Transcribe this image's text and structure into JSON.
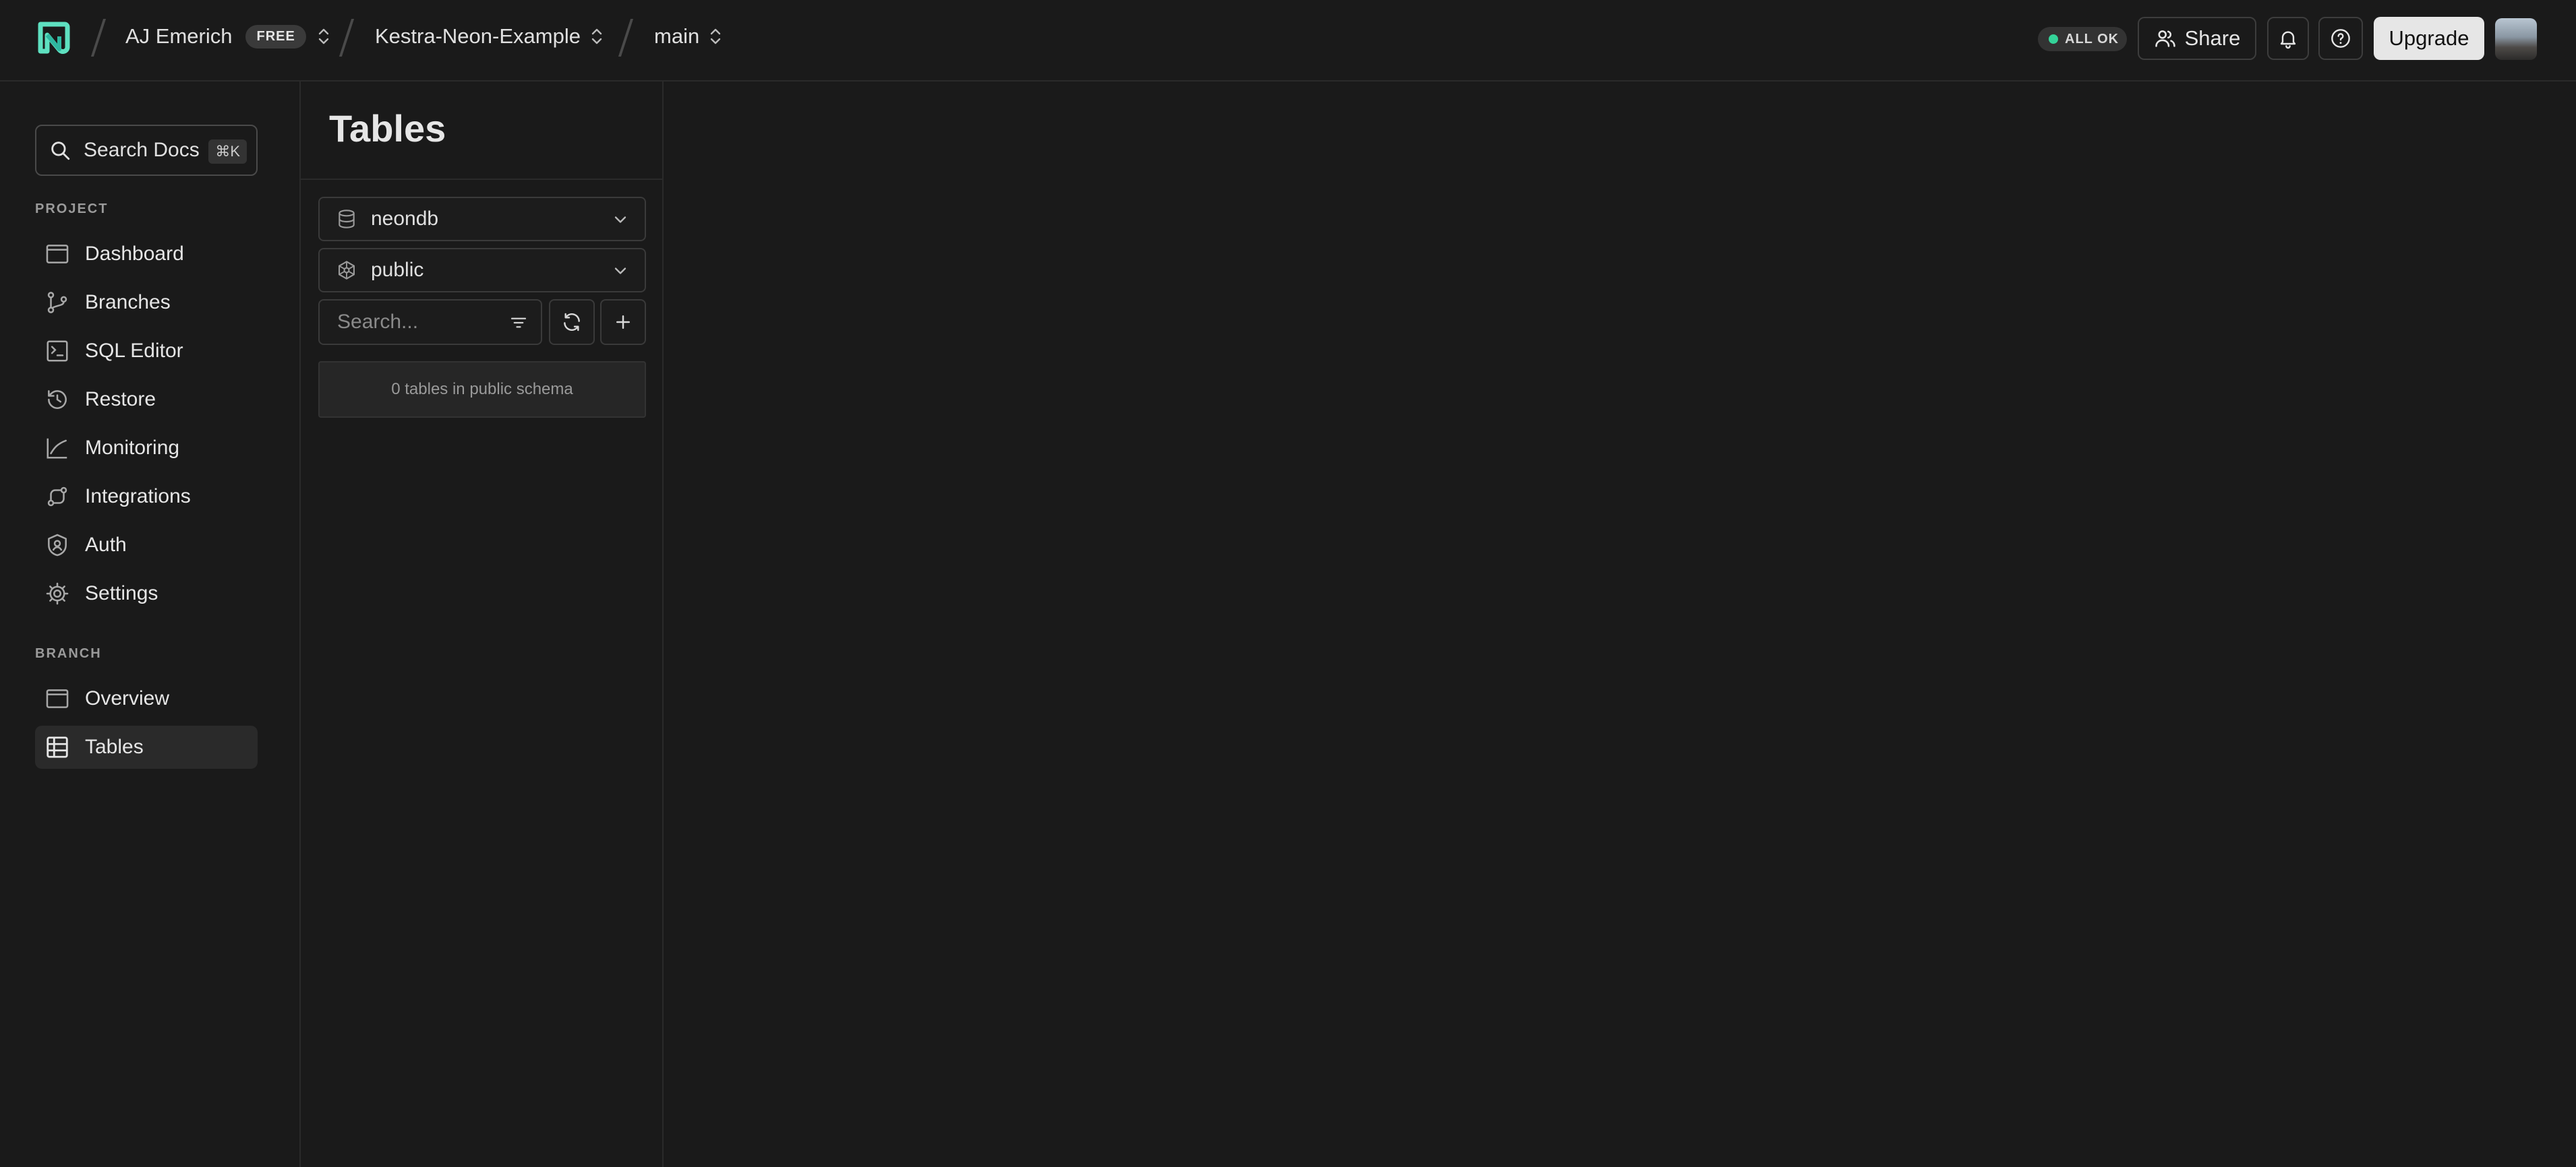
{
  "topbar": {
    "org_name": "AJ Emerich",
    "org_plan_badge": "FREE",
    "project_name": "Kestra-Neon-Example",
    "branch_name": "main",
    "status_text": "ALL OK",
    "status_color": "#34d399",
    "share_label": "Share",
    "upgrade_label": "Upgrade",
    "icons": [
      "neon-logo-icon",
      "chevron-up-down-icon",
      "users-icon",
      "bell-icon",
      "help-circle-icon"
    ]
  },
  "sidebar": {
    "search": {
      "label": "Search Docs",
      "shortcut": "⌘K"
    },
    "project_section": "PROJECT",
    "project_items": [
      {
        "label": "Dashboard",
        "icon": "dashboard-icon"
      },
      {
        "label": "Branches",
        "icon": "branches-icon"
      },
      {
        "label": "SQL Editor",
        "icon": "sql-editor-icon"
      },
      {
        "label": "Restore",
        "icon": "restore-icon"
      },
      {
        "label": "Monitoring",
        "icon": "monitoring-icon"
      },
      {
        "label": "Integrations",
        "icon": "integrations-icon"
      },
      {
        "label": "Auth",
        "icon": "auth-icon"
      },
      {
        "label": "Settings",
        "icon": "settings-icon"
      }
    ],
    "branch_section": "BRANCH",
    "branch_items": [
      {
        "label": "Overview",
        "icon": "overview-icon"
      },
      {
        "label": "Tables",
        "icon": "tables-icon",
        "active": true
      }
    ]
  },
  "tables_panel": {
    "title": "Tables",
    "database": "neondb",
    "schema": "public",
    "search_placeholder": "Search...",
    "empty_message": "0 tables in public schema"
  }
}
